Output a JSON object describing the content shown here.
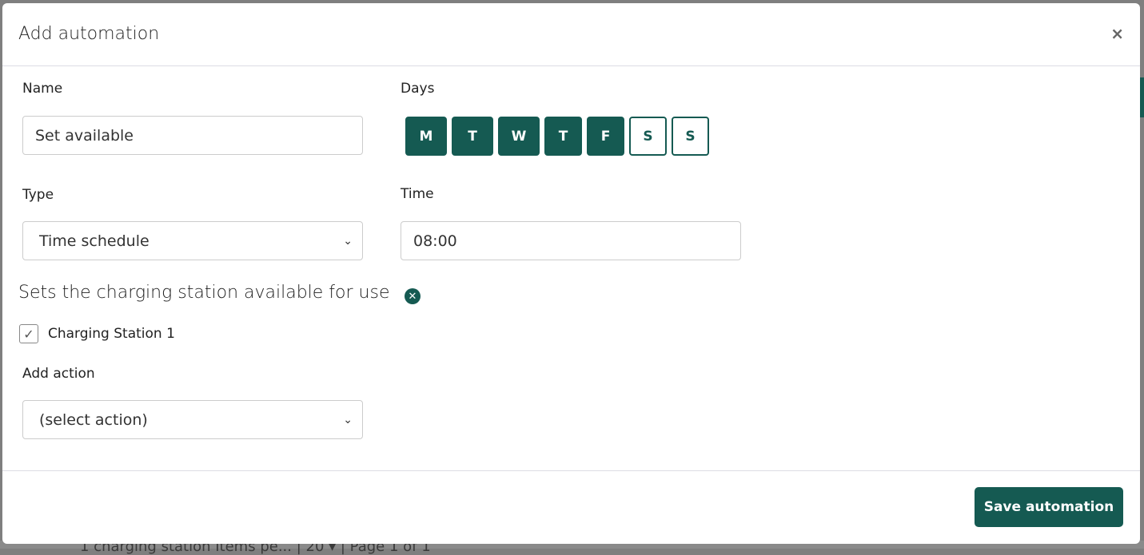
{
  "background": {
    "pagination_text": "1 charging station   Items pe...  | 20 ▾ |      Page 1 of 1"
  },
  "modal": {
    "title": "Add automation",
    "close_icon": "×",
    "name": {
      "label": "Name",
      "value": "Set available"
    },
    "days": {
      "label": "Days",
      "items": [
        {
          "label": "M",
          "selected": true
        },
        {
          "label": "T",
          "selected": true
        },
        {
          "label": "W",
          "selected": true
        },
        {
          "label": "T",
          "selected": true
        },
        {
          "label": "F",
          "selected": true
        },
        {
          "label": "S",
          "selected": false
        },
        {
          "label": "S",
          "selected": false
        }
      ]
    },
    "type": {
      "label": "Type",
      "value": "Time schedule"
    },
    "time": {
      "label": "Time",
      "value": "08:00"
    },
    "action_description": "Sets the charging station available for use",
    "station": {
      "label": "Charging Station 1",
      "checked": true
    },
    "add_action": {
      "label": "Add action",
      "value": "(select action)"
    },
    "save_label": "Save automation"
  },
  "colors": {
    "accent": "#155a52"
  }
}
